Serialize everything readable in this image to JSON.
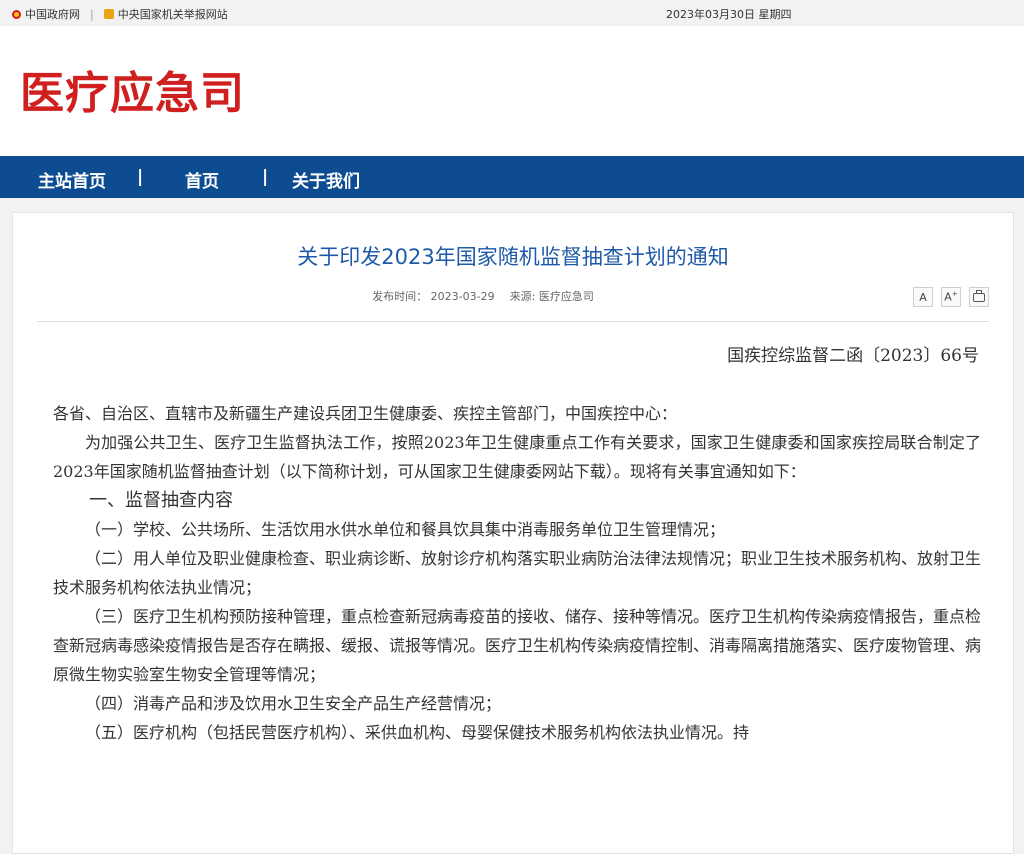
{
  "topbar": {
    "gov_link": "中国政府网",
    "separator": "|",
    "supervision_link": "中央国家机关举报网站",
    "date": "2023年03月30日 星期四"
  },
  "header": {
    "logo_text": "医疗应急司"
  },
  "nav": {
    "items": [
      "主站首页",
      "首页",
      "关于我们"
    ],
    "separator": "|"
  },
  "article": {
    "title": "关于印发2023年国家随机监督抽查计划的通知",
    "publish_label": "发布时间：",
    "publish_date": "2023-03-29",
    "source_label": "来源:",
    "source": "医疗应急司",
    "tools": {
      "font_smaller": "A",
      "font_larger": "A",
      "font_larger_sup": "+"
    },
    "doc_number": "国疾控综监督二函〔2023〕66号",
    "paragraphs": [
      "各省、自治区、直辖市及新疆生产建设兵团卫生健康委、疾控主管部门，中国疾控中心：",
      "为加强公共卫生、医疗卫生监督执法工作，按照2023年卫生健康重点工作有关要求，国家卫生健康委和国家疾控局联合制定了2023年国家随机监督抽查计划（以下简称计划，可从国家卫生健康委网站下载）。现将有关事宜通知如下：",
      "一、监督抽查内容",
      "（一）学校、公共场所、生活饮用水供水单位和餐具饮具集中消毒服务单位卫生管理情况；",
      "（二）用人单位及职业健康检查、职业病诊断、放射诊疗机构落实职业病防治法律法规情况；职业卫生技术服务机构、放射卫生技术服务机构依法执业情况；",
      "（三）医疗卫生机构预防接种管理，重点检查新冠病毒疫苗的接收、储存、接种等情况。医疗卫生机构传染病疫情报告，重点检查新冠病毒感染疫情报告是否存在瞒报、缓报、谎报等情况。医疗卫生机构传染病疫情控制、消毒隔离措施落实、医疗废物管理、病原微生物实验室生物安全管理等情况；",
      "（四）消毒产品和涉及饮用水卫生安全产品生产经营情况；",
      "（五）医疗机构（包括民营医疗机构）、采供血机构、母婴保健技术服务机构依法执业情况。持"
    ]
  }
}
